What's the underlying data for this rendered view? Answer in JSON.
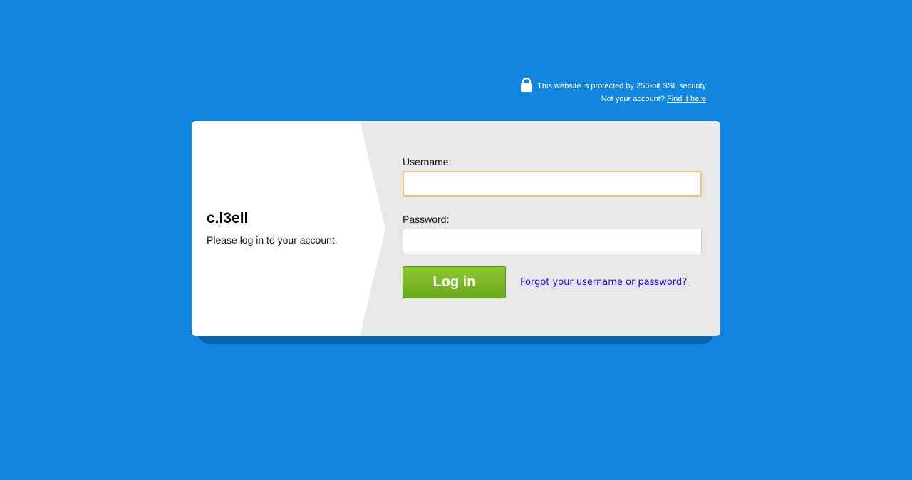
{
  "security": {
    "notice": "This website is protected by 256-bit SSL security",
    "not_account_text": "Not your account?",
    "find_link": "Find it here",
    "icon": "lock-icon"
  },
  "brand": {
    "title": "c.l3ell",
    "subtitle": "Please log in to your account."
  },
  "form": {
    "username_label": "Username:",
    "username_value": "",
    "password_label": "Password:",
    "password_value": "",
    "login_button": "Log in",
    "forgot_link": "Forgot your username or password?"
  },
  "colors": {
    "background": "#0f84e0",
    "card_right": "#e8e8e8",
    "button": "#7cb828",
    "focus_border": "#f0c27a",
    "link": "#1a0dcc"
  }
}
